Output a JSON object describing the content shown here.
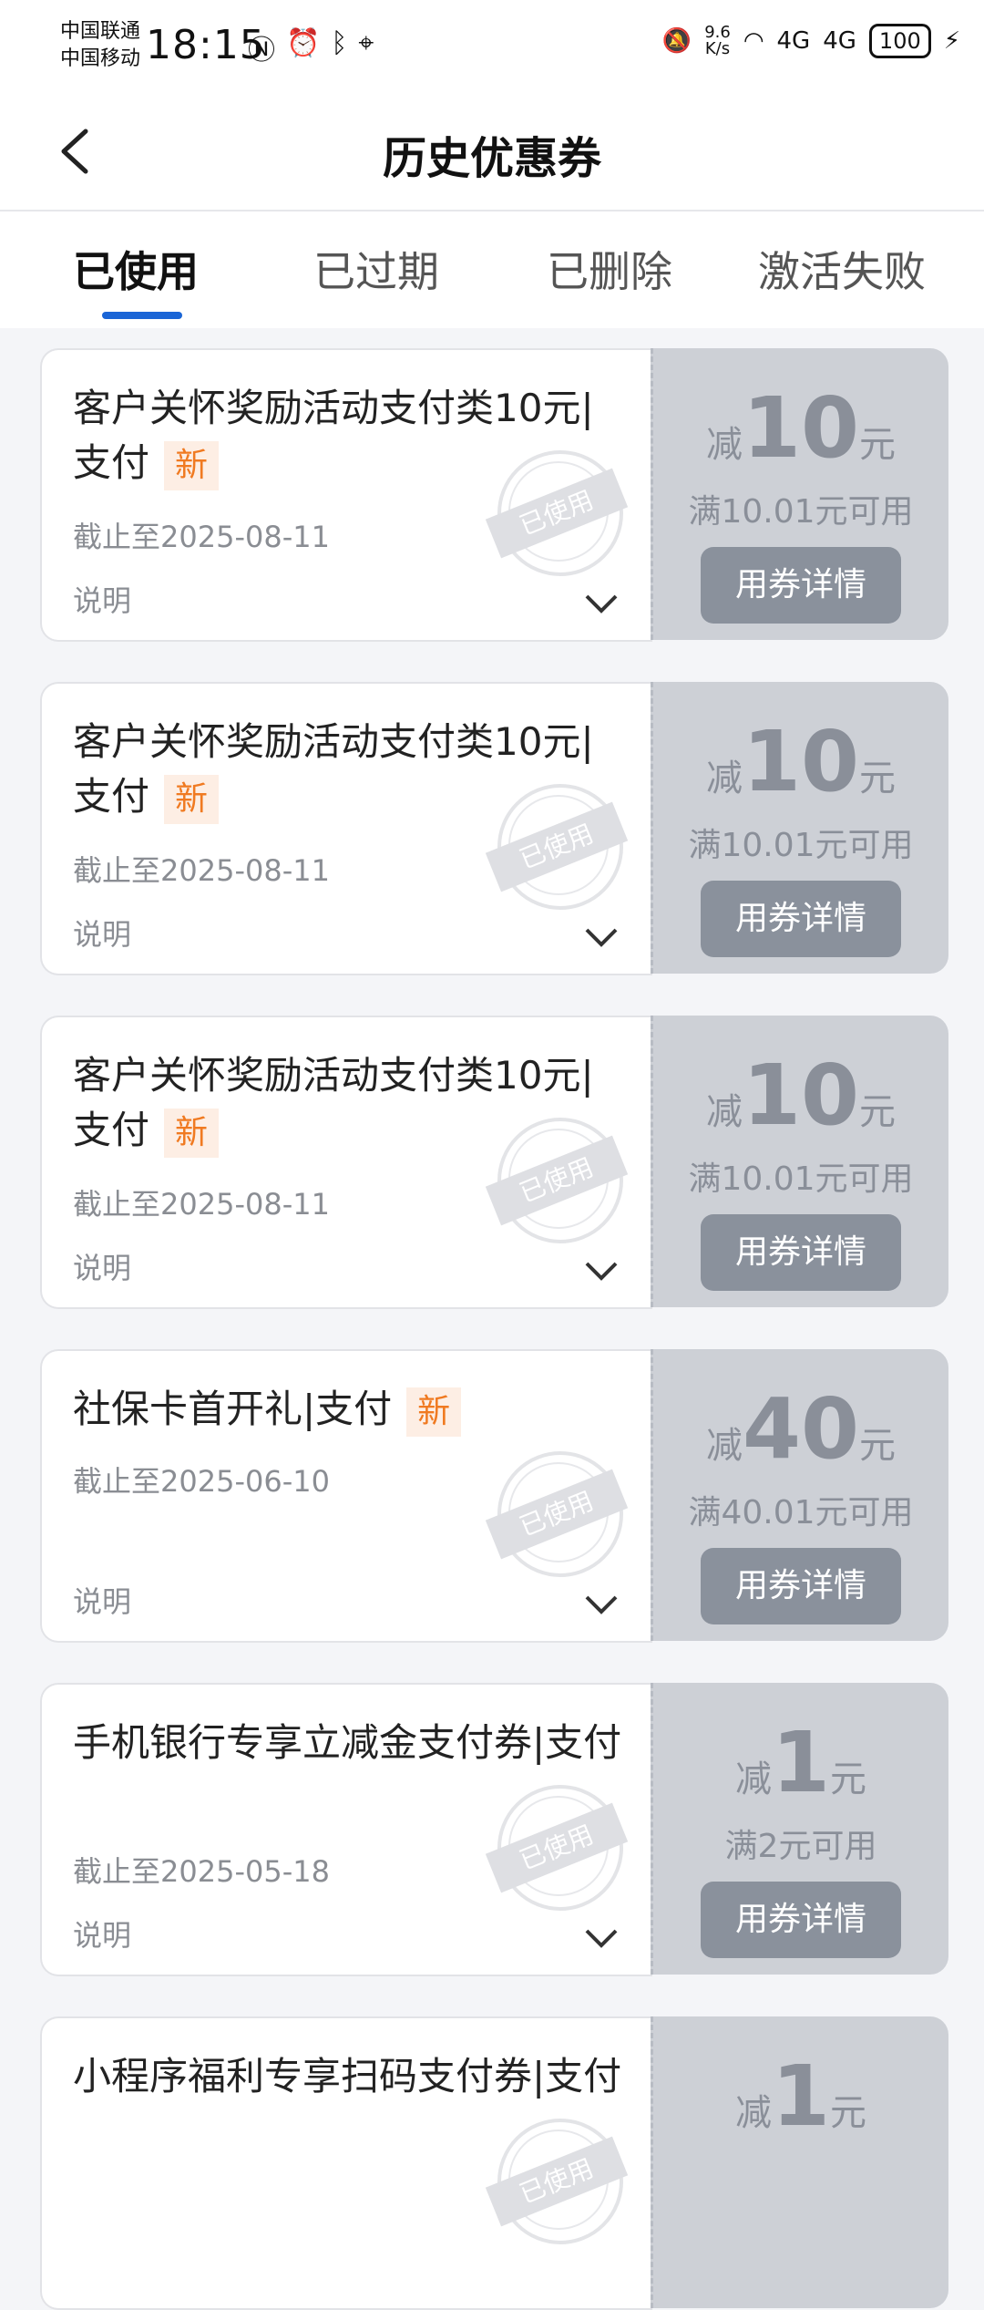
{
  "status_bar": {
    "carrier1": "中国联通",
    "carrier2": "中国移动",
    "time": "18:15",
    "net_speed_value": "9.6",
    "net_speed_unit": "K/s",
    "signal1": "4G",
    "signal2": "4G",
    "battery": "100"
  },
  "header": {
    "title": "历史优惠券"
  },
  "tabs": [
    {
      "label": "已使用",
      "active": true
    },
    {
      "label": "已过期"
    },
    {
      "label": "已删除"
    },
    {
      "label": "激活失败"
    }
  ],
  "coupons": [
    {
      "title": "客户关怀奖励活动支付类10元|支付",
      "badge": "新",
      "date": "截止至2025-08-11",
      "desc_label": "说明",
      "stamp": "已使用",
      "prefix": "减",
      "amount": "10",
      "unit": "元",
      "condition": "满10.01元可用",
      "button": "用券详情"
    },
    {
      "title": "客户关怀奖励活动支付类10元|支付",
      "badge": "新",
      "date": "截止至2025-08-11",
      "desc_label": "说明",
      "stamp": "已使用",
      "prefix": "减",
      "amount": "10",
      "unit": "元",
      "condition": "满10.01元可用",
      "button": "用券详情"
    },
    {
      "title": "客户关怀奖励活动支付类10元|支付",
      "badge": "新",
      "date": "截止至2025-08-11",
      "desc_label": "说明",
      "stamp": "已使用",
      "prefix": "减",
      "amount": "10",
      "unit": "元",
      "condition": "满10.01元可用",
      "button": "用券详情"
    },
    {
      "title": "社保卡首开礼|支付",
      "badge": "新",
      "date": "截止至2025-06-10",
      "desc_label": "说明",
      "stamp": "已使用",
      "prefix": "减",
      "amount": "40",
      "unit": "元",
      "condition": "满40.01元可用",
      "button": "用券详情"
    },
    {
      "title": "手机银行专享立减金支付券|支付",
      "badge": "",
      "date": "截止至2025-05-18",
      "desc_label": "说明",
      "stamp": "已使用",
      "prefix": "减",
      "amount": "1",
      "unit": "元",
      "condition": "满2元可用",
      "button": "用券详情"
    },
    {
      "title": "小程序福利专享扫码支付券|支付",
      "badge": "",
      "date": "",
      "desc_label": "",
      "stamp": "已使用",
      "prefix": "减",
      "amount": "1",
      "unit": "元",
      "condition": "",
      "button": ""
    }
  ]
}
